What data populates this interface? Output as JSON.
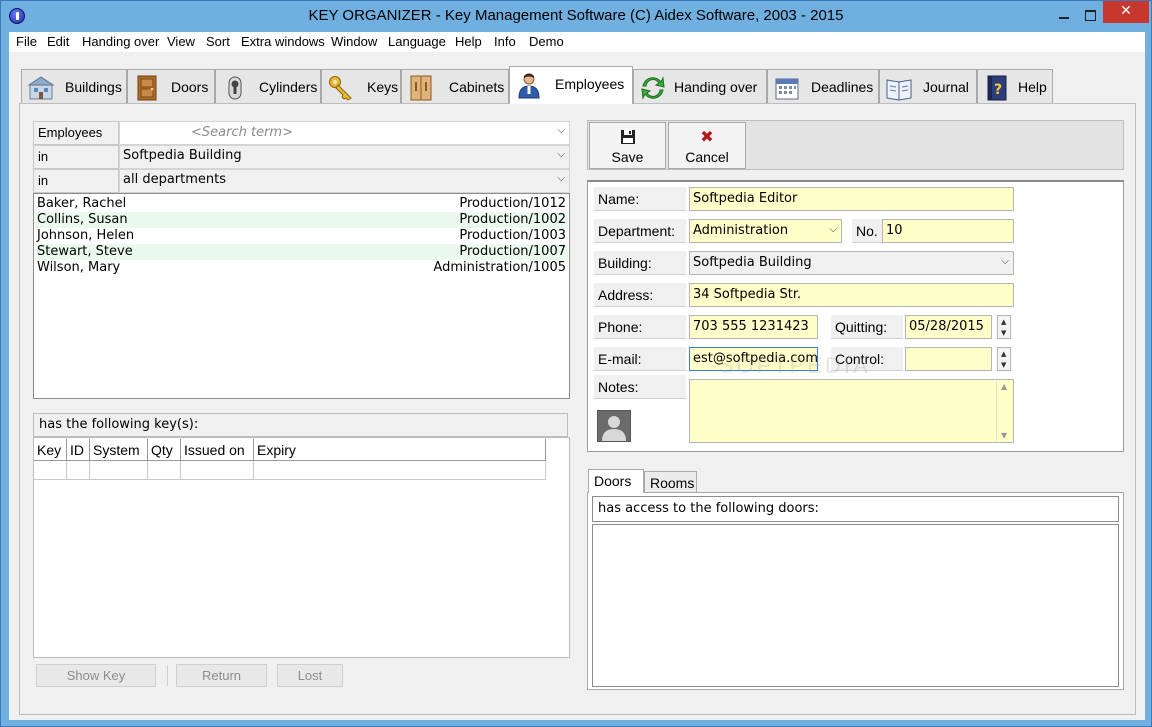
{
  "window": {
    "title": "KEY ORGANIZER  -  Key Management Software     (C) Aidex Software, 2003 - 2015",
    "close_glyph": "✕"
  },
  "menu": [
    "File",
    "Edit",
    "Handing over",
    "View",
    "Sort",
    "Extra windows",
    "Window",
    "Language",
    "Help",
    "Info",
    "Demo"
  ],
  "tabs": [
    {
      "label": "Buildings",
      "icon": "buildings-icon"
    },
    {
      "label": "Doors",
      "icon": "door-icon"
    },
    {
      "label": "Cylinders",
      "icon": "cylinder-icon"
    },
    {
      "label": "Keys",
      "icon": "key-icon"
    },
    {
      "label": "Cabinets",
      "icon": "cabinet-icon"
    },
    {
      "label": "Employees",
      "icon": "employee-icon",
      "active": true
    },
    {
      "label": "Handing over",
      "icon": "handover-icon"
    },
    {
      "label": "Deadlines",
      "icon": "calendar-icon"
    },
    {
      "label": "Journal",
      "icon": "journal-icon"
    },
    {
      "label": "Help",
      "icon": "help-book-icon"
    }
  ],
  "filter": {
    "employees_label": "Employees",
    "search_placeholder": "<Search term>",
    "in_label_1": "in",
    "building_value": "Softpedia Building",
    "in_label_2": "in",
    "department_value": "all departments"
  },
  "employees": [
    {
      "name": "Baker, Rachel",
      "dept": "Production/1012"
    },
    {
      "name": "Collins, Susan",
      "dept": "Production/1002"
    },
    {
      "name": "Johnson, Helen",
      "dept": "Production/1003"
    },
    {
      "name": "Stewart, Steve",
      "dept": "Production/1007"
    },
    {
      "name": "Wilson, Mary",
      "dept": "Administration/1005"
    }
  ],
  "keys_section": {
    "header": "has the following key(s):",
    "columns": [
      "Key",
      "ID",
      "System",
      "Qty",
      "Issued on",
      "Expiry"
    ]
  },
  "bottom_buttons": {
    "show_key": "Show Key",
    "return": "Return",
    "lost": "Lost"
  },
  "toolbar": {
    "save_label": "Save",
    "cancel_label": "Cancel",
    "cancel_glyph": "✖"
  },
  "detail": {
    "name_label": "Name:",
    "name_value": "Softpedia Editor",
    "department_label": "Department:",
    "department_value": "Administration",
    "no_label": "No.",
    "no_value": "10",
    "building_label": "Building:",
    "building_value": "Softpedia Building",
    "address_label": "Address:",
    "address_value": "34 Softpedia Str.",
    "phone_label": "Phone:",
    "phone_value": "703 555 1231423",
    "quitting_label": "Quitting:",
    "quitting_value": "05/28/2015",
    "email_label": "E-mail:",
    "email_value": "est@softpedia.com",
    "control_label": "Control:",
    "control_value": "",
    "notes_label": "Notes:",
    "notes_value": ""
  },
  "access": {
    "tab_doors": "Doors",
    "tab_rooms": "Rooms",
    "header": "has access to the following doors:"
  },
  "watermark": "SOFTPEDIA"
}
